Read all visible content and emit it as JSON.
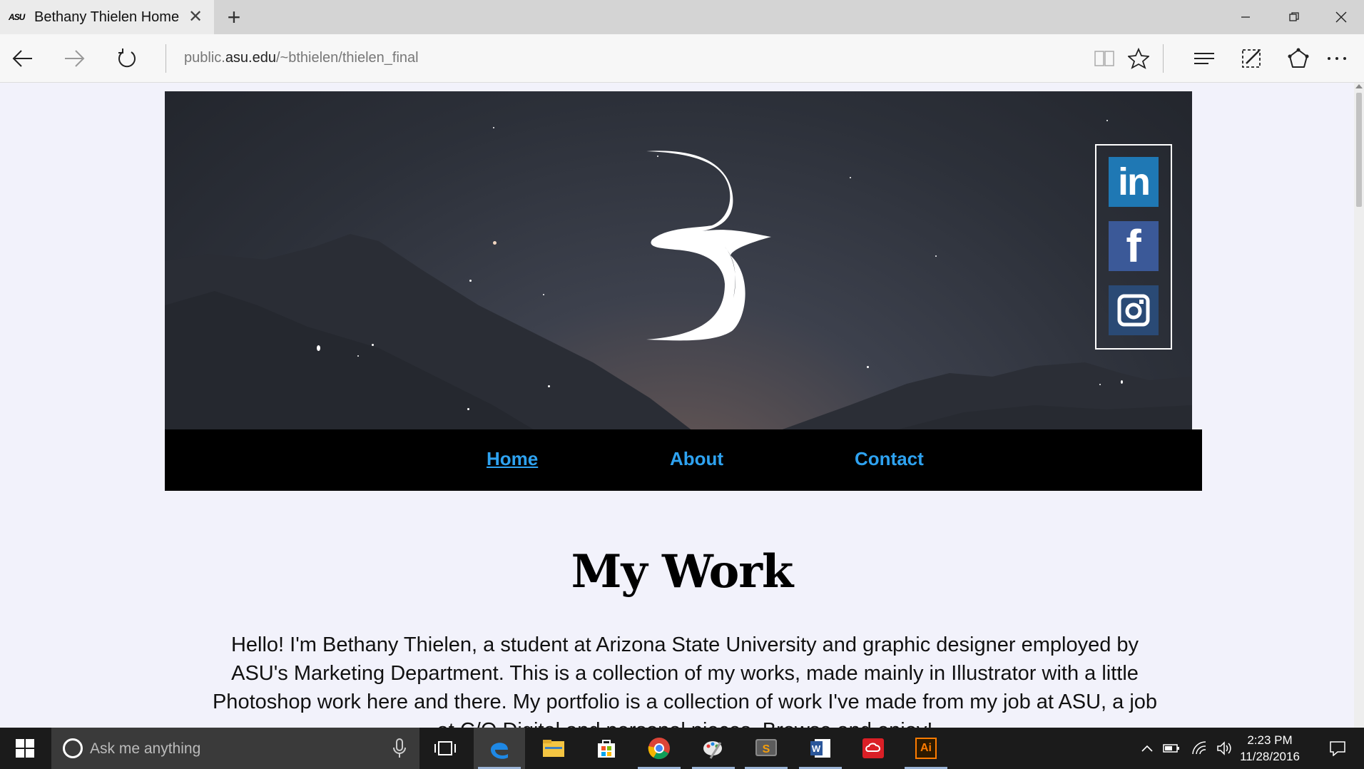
{
  "browser": {
    "tab_title": "Bethany Thielen Home",
    "favicon_text": "ASU",
    "url_prefix": "public.",
    "url_domain": "asu.edu",
    "url_path": "/~bthielen/thielen_final"
  },
  "site": {
    "nav": {
      "home": "Home",
      "about": "About",
      "contact": "Contact"
    },
    "social": {
      "linkedin": "in",
      "facebook": "f"
    },
    "heading": "My Work",
    "intro": "Hello! I'm Bethany Thielen, a student at Arizona State University and graphic designer employed by ASU's Marketing Department. This is a collection of my works, made mainly in Illustrator with a little Photoshop work here and there. My portfolio is a collection of work I've made from my job at ASU, a job at C/O Digital and personal pieces. Browse and enjoy!"
  },
  "taskbar": {
    "search_placeholder": "Ask me anything",
    "illustrator_label": "Ai",
    "time": "2:23 PM",
    "date": "11/28/2016"
  },
  "colors": {
    "link": "#2ea2f0",
    "nav_bg": "#000000",
    "page_bg": "#f2f2fb",
    "linkedin": "#1f78b4",
    "facebook": "#3b5998"
  }
}
